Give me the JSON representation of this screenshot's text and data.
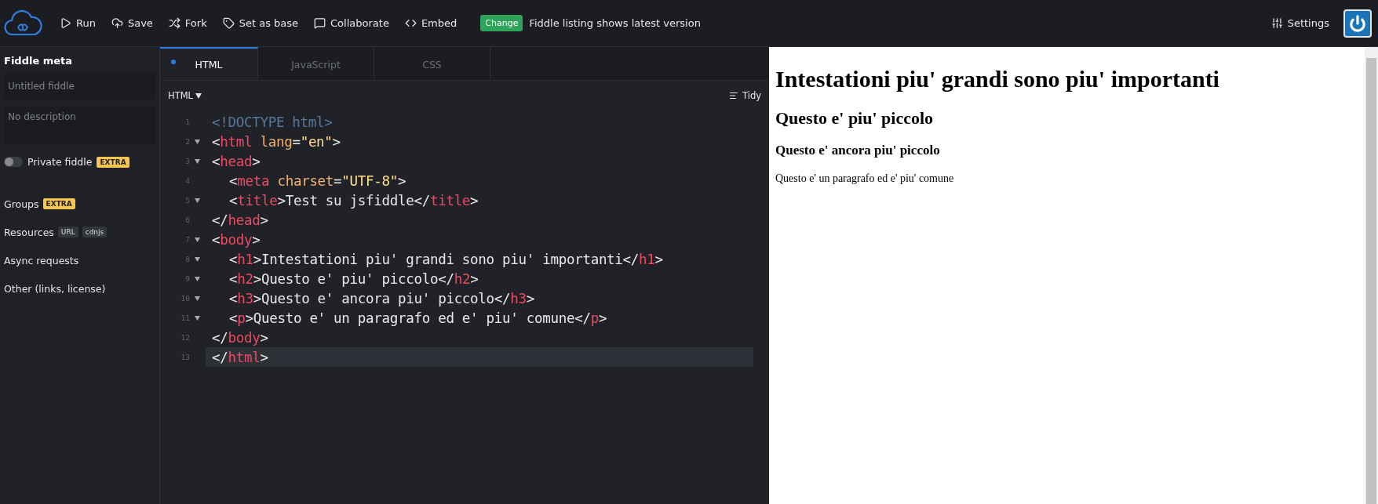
{
  "toolbar": {
    "actions": [
      {
        "kind": "run",
        "label": "Run"
      },
      {
        "kind": "save",
        "label": "Save"
      },
      {
        "kind": "fork",
        "label": "Fork"
      },
      {
        "kind": "base",
        "label": "Set as base"
      },
      {
        "kind": "collaborate",
        "label": "Collaborate"
      },
      {
        "kind": "embed",
        "label": "Embed"
      }
    ],
    "notice": {
      "badge": "Change",
      "text": "Fiddle listing shows latest version"
    },
    "settings": "Settings"
  },
  "sidebar": {
    "title": "Fiddle meta",
    "title_field": {
      "placeholder": "Untitled fiddle"
    },
    "description_field": {
      "placeholder": "No description"
    },
    "private": {
      "label": "Private fiddle",
      "on": false,
      "badge": "EXTRA"
    },
    "items": [
      {
        "label": "Groups",
        "badges": [
          {
            "kind": "extra",
            "text": "EXTRA"
          }
        ]
      },
      {
        "label": "Resources",
        "badges": [
          {
            "kind": "plain",
            "text": "URL"
          },
          {
            "kind": "plain",
            "text": "cdnjs"
          }
        ]
      },
      {
        "label": "Async requests"
      },
      {
        "label": "Other (links, license)"
      }
    ]
  },
  "tabs": [
    {
      "label": "HTML",
      "selected": true,
      "modified": true
    },
    {
      "label": "JavaScript",
      "selected": false,
      "modified": false
    },
    {
      "label": "CSS",
      "selected": false,
      "modified": false
    }
  ],
  "editor": {
    "language": "HTML",
    "tidy": "Tidy",
    "lines": [
      {
        "number": "1",
        "foldable": false,
        "active": false,
        "tokens": [
          {
            "kind": "doctype",
            "text": "<!DOCTYPE html>"
          }
        ]
      },
      {
        "number": "2",
        "foldable": true,
        "active": false,
        "tokens": [
          {
            "kind": "punct",
            "text": "<"
          },
          {
            "kind": "tag",
            "text": "html"
          },
          {
            "kind": "attr",
            "text": " lang"
          },
          {
            "kind": "punct",
            "text": "="
          },
          {
            "kind": "string",
            "text": "\"en\""
          },
          {
            "kind": "punct",
            "text": ">"
          }
        ]
      },
      {
        "number": "3",
        "foldable": true,
        "active": false,
        "tokens": [
          {
            "kind": "punct",
            "text": "<"
          },
          {
            "kind": "tag",
            "text": "head"
          },
          {
            "kind": "punct",
            "text": ">"
          }
        ],
        "children": [
          {
            "number": "4",
            "foldable": false,
            "active": false,
            "tokens": [
              {
                "kind": "punct",
                "text": "<"
              },
              {
                "kind": "tag",
                "text": "meta"
              },
              {
                "kind": "attr",
                "text": " charset"
              },
              {
                "kind": "punct",
                "text": "="
              },
              {
                "kind": "string",
                "text": "\"UTF-8\""
              },
              {
                "kind": "punct",
                "text": ">"
              }
            ]
          },
          {
            "number": "5",
            "foldable": true,
            "active": false,
            "tokens": [
              {
                "kind": "punct",
                "text": "<"
              },
              {
                "kind": "tag",
                "text": "title"
              },
              {
                "kind": "punct",
                "text": ">Test su jsfiddle</"
              },
              {
                "kind": "tag",
                "text": "title"
              },
              {
                "kind": "punct",
                "text": ">"
              }
            ]
          }
        ]
      },
      {
        "number": "6",
        "foldable": false,
        "active": false,
        "tokens": [
          {
            "kind": "punct",
            "text": "</"
          },
          {
            "kind": "tag",
            "text": "head"
          },
          {
            "kind": "punct",
            "text": ">"
          }
        ]
      },
      {
        "number": "7",
        "foldable": true,
        "active": false,
        "tokens": [
          {
            "kind": "punct",
            "text": "<"
          },
          {
            "kind": "tag",
            "text": "body"
          },
          {
            "kind": "punct",
            "text": ">"
          }
        ],
        "children": [
          {
            "number": "8",
            "foldable": true,
            "active": false,
            "tokens": [
              {
                "kind": "punct",
                "text": "<"
              },
              {
                "kind": "tag",
                "text": "h1"
              },
              {
                "kind": "punct",
                "text": ">Intestationi piu' grandi sono piu' importanti</"
              },
              {
                "kind": "tag",
                "text": "h1"
              },
              {
                "kind": "punct",
                "text": ">"
              }
            ]
          },
          {
            "number": "9",
            "foldable": true,
            "active": false,
            "tokens": [
              {
                "kind": "punct",
                "text": "<"
              },
              {
                "kind": "tag",
                "text": "h2"
              },
              {
                "kind": "punct",
                "text": ">Questo e' piu' piccolo</"
              },
              {
                "kind": "tag",
                "text": "h2"
              },
              {
                "kind": "punct",
                "text": ">"
              }
            ]
          },
          {
            "number": "10",
            "foldable": true,
            "active": false,
            "tokens": [
              {
                "kind": "punct",
                "text": "<"
              },
              {
                "kind": "tag",
                "text": "h3"
              },
              {
                "kind": "punct",
                "text": ">Questo e' ancora piu' piccolo</"
              },
              {
                "kind": "tag",
                "text": "h3"
              },
              {
                "kind": "punct",
                "text": ">"
              }
            ]
          },
          {
            "number": "11",
            "foldable": true,
            "active": false,
            "tokens": [
              {
                "kind": "punct",
                "text": "<"
              },
              {
                "kind": "tag",
                "text": "p"
              },
              {
                "kind": "punct",
                "text": ">Questo e' un paragrafo ed e' piu' comune</"
              },
              {
                "kind": "tag",
                "text": "p"
              },
              {
                "kind": "punct",
                "text": ">"
              }
            ]
          }
        ]
      },
      {
        "number": "12",
        "foldable": false,
        "active": false,
        "tokens": [
          {
            "kind": "punct",
            "text": "</"
          },
          {
            "kind": "tag",
            "text": "body"
          },
          {
            "kind": "punct",
            "text": ">"
          }
        ]
      },
      {
        "number": "13",
        "foldable": false,
        "active": true,
        "tokens": [
          {
            "kind": "punct",
            "text": "</"
          },
          {
            "kind": "tag",
            "text": "html"
          },
          {
            "kind": "punct",
            "text": ">"
          }
        ]
      }
    ]
  },
  "preview": {
    "blocks": [
      {
        "kind": "h1",
        "text": "Intestationi piu' grandi sono piu' importanti"
      },
      {
        "kind": "h2",
        "text": "Questo e' piu' piccolo"
      },
      {
        "kind": "h3",
        "text": "Questo e' ancora piu' piccolo"
      },
      {
        "kind": "p",
        "text": "Questo e' un paragrafo ed e' piu' comune"
      }
    ]
  }
}
